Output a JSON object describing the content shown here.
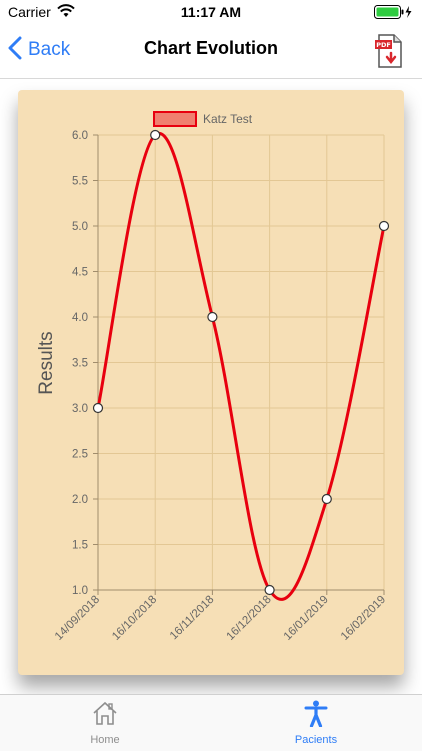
{
  "status": {
    "carrier": "Carrier",
    "time": "11:17 AM"
  },
  "nav": {
    "back_label": "Back",
    "title": "Chart Evolution",
    "pdf_badge": "PDF"
  },
  "tabs": [
    {
      "label": "Home",
      "icon": "home-icon"
    },
    {
      "label": "Pacients",
      "icon": "person-icon"
    }
  ],
  "colors": {
    "accent": "#2f7df6",
    "line": "#e8000f",
    "card": "#f6dfb6"
  },
  "chart_data": {
    "type": "line",
    "title": "",
    "xlabel": "",
    "ylabel": "Results",
    "ylim": [
      1.0,
      6.0
    ],
    "yticks": [
      "1.0",
      "1.5",
      "2.0",
      "2.5",
      "3.0",
      "3.5",
      "4.0",
      "4.5",
      "5.0",
      "5.5",
      "6.0"
    ],
    "categories": [
      "14/09/2018",
      "16/10/2018",
      "16/11/2018",
      "16/12/2018",
      "16/01/2019",
      "16/02/2019"
    ],
    "series": [
      {
        "name": "Katz Test",
        "values": [
          3,
          6,
          4,
          1,
          2,
          5
        ]
      }
    ],
    "legend": "top",
    "grid": true
  }
}
